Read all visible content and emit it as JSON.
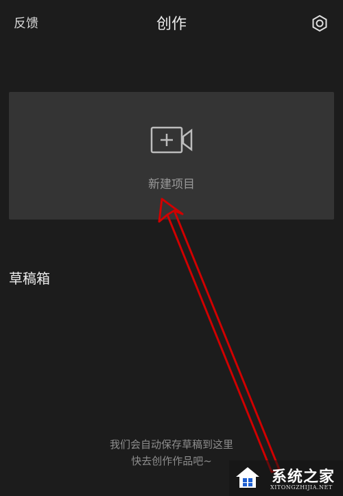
{
  "header": {
    "feedback_label": "反馈",
    "title": "创作",
    "settings_icon": "gear-icon"
  },
  "new_project": {
    "icon": "video-camera-plus-icon",
    "label": "新建项目"
  },
  "drafts": {
    "title": "草稿箱",
    "empty_line1": "我们会自动保存草稿到这里",
    "empty_line2": "快去创作作品吧~"
  },
  "watermark": {
    "text": "系统之家",
    "subtext": "XITONGZHIJIA.NET"
  },
  "colors": {
    "background": "#1c1c1c",
    "card": "#343434",
    "annotation_arrow": "#d00000"
  }
}
